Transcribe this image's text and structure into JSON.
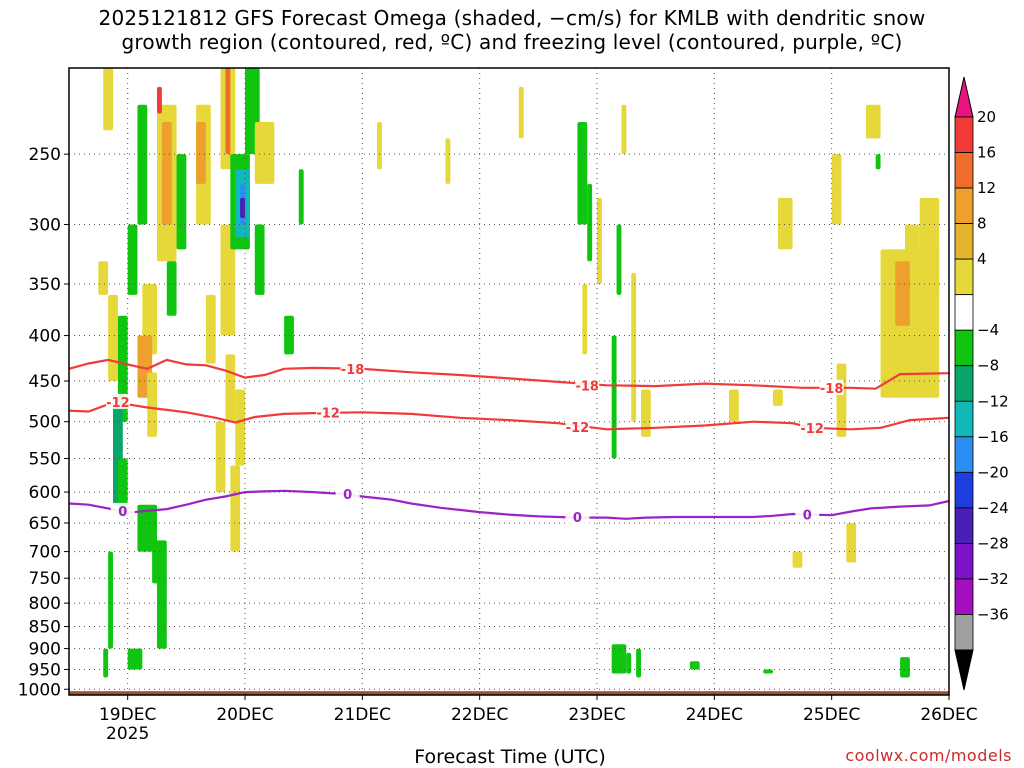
{
  "title": {
    "line1": "2025121812 GFS Forecast Omega (shaded, −cm/s) for KMLB with dendritic snow",
    "line2": "growth region (contoured, red, ºC) and freezing level (contoured, purple, ºC)"
  },
  "credit": "coolwx.com/models",
  "chart_data": {
    "type": "heatmap",
    "xlabel": "Forecast Time (UTC)",
    "x_ticks": [
      {
        "label": "19DEC",
        "sub": "2025",
        "hour": 12
      },
      {
        "label": "20DEC",
        "sub": "",
        "hour": 36
      },
      {
        "label": "21DEC",
        "sub": "",
        "hour": 60
      },
      {
        "label": "22DEC",
        "sub": "",
        "hour": 84
      },
      {
        "label": "23DEC",
        "sub": "",
        "hour": 108
      },
      {
        "label": "24DEC",
        "sub": "",
        "hour": 132
      },
      {
        "label": "25DEC",
        "sub": "",
        "hour": 156
      },
      {
        "label": "26DEC",
        "sub": "",
        "hour": 180
      }
    ],
    "xlim_hours": [
      0,
      180
    ],
    "y_ticks": [
      250,
      300,
      350,
      400,
      450,
      500,
      550,
      600,
      650,
      700,
      750,
      800,
      850,
      900,
      950,
      1000
    ],
    "ylim": [
      200,
      1015
    ],
    "y_scale": "log",
    "grid": true,
    "colorbar": {
      "labels": [
        20,
        16,
        12,
        8,
        4,
        -4,
        -8,
        -12,
        -16,
        -20,
        -24,
        -28,
        -32,
        -36
      ],
      "colors": [
        "#e8157e",
        "#f23a36",
        "#ef6d2a",
        "#eda02c",
        "#e3b52c",
        "#e6d83a",
        "#ffffff",
        "#0fc50f",
        "#0aa56a",
        "#12b8b8",
        "#2a8ef2",
        "#1f3ee0",
        "#4a1fb5",
        "#7a12c8",
        "#a40fbf",
        "#a0a0a0",
        "#000000"
      ]
    },
    "contours": [
      {
        "name": "-18",
        "color": "#ef3b3b",
        "points": [
          [
            0,
            436
          ],
          [
            4,
            430
          ],
          [
            8,
            426
          ],
          [
            12,
            431
          ],
          [
            16,
            436
          ],
          [
            18,
            431
          ],
          [
            20,
            426
          ],
          [
            24,
            431
          ],
          [
            28,
            432
          ],
          [
            32,
            438
          ],
          [
            36,
            446
          ],
          [
            40,
            443
          ],
          [
            44,
            436
          ],
          [
            50,
            435
          ],
          [
            60,
            436
          ],
          [
            70,
            440
          ],
          [
            80,
            443
          ],
          [
            90,
            447
          ],
          [
            100,
            451
          ],
          [
            110,
            455
          ],
          [
            120,
            456
          ],
          [
            130,
            453
          ],
          [
            140,
            455
          ],
          [
            150,
            458
          ],
          [
            160,
            458
          ],
          [
            165,
            459
          ],
          [
            170,
            442
          ],
          [
            180,
            441
          ]
        ],
        "labels": [
          [
            58,
            436
          ],
          [
            106,
            455
          ],
          [
            156,
            458
          ]
        ]
      },
      {
        "name": "-12",
        "color": "#ef3b3b",
        "points": [
          [
            0,
            486
          ],
          [
            4,
            487
          ],
          [
            8,
            478
          ],
          [
            12,
            478
          ],
          [
            16,
            482
          ],
          [
            20,
            485
          ],
          [
            24,
            488
          ],
          [
            30,
            495
          ],
          [
            34,
            501
          ],
          [
            38,
            494
          ],
          [
            44,
            490
          ],
          [
            50,
            489
          ],
          [
            60,
            488
          ],
          [
            70,
            490
          ],
          [
            80,
            495
          ],
          [
            90,
            498
          ],
          [
            100,
            502
          ],
          [
            110,
            510
          ],
          [
            120,
            508
          ],
          [
            130,
            505
          ],
          [
            140,
            500
          ],
          [
            148,
            502
          ],
          [
            152,
            508
          ],
          [
            160,
            510
          ],
          [
            166,
            508
          ],
          [
            172,
            498
          ],
          [
            180,
            495
          ]
        ],
        "labels": [
          [
            10,
            475
          ],
          [
            53,
            488
          ],
          [
            104,
            507
          ],
          [
            152,
            508
          ]
        ]
      },
      {
        "name": "0",
        "color": "#9b22c4",
        "points": [
          [
            0,
            618
          ],
          [
            4,
            620
          ],
          [
            8,
            626
          ],
          [
            12,
            633
          ],
          [
            16,
            630
          ],
          [
            20,
            627
          ],
          [
            24,
            620
          ],
          [
            28,
            612
          ],
          [
            32,
            607
          ],
          [
            36,
            600
          ],
          [
            40,
            599
          ],
          [
            44,
            598
          ],
          [
            50,
            600
          ],
          [
            56,
            603
          ],
          [
            60,
            607
          ],
          [
            66,
            612
          ],
          [
            70,
            618
          ],
          [
            76,
            625
          ],
          [
            84,
            632
          ],
          [
            90,
            636
          ],
          [
            96,
            639
          ],
          [
            100,
            640
          ],
          [
            104,
            641
          ],
          [
            110,
            641
          ],
          [
            114,
            643
          ],
          [
            118,
            641
          ],
          [
            124,
            640
          ],
          [
            130,
            640
          ],
          [
            140,
            640
          ],
          [
            144,
            638
          ],
          [
            148,
            635
          ],
          [
            152,
            636
          ],
          [
            156,
            637
          ],
          [
            160,
            631
          ],
          [
            164,
            626
          ],
          [
            170,
            623
          ],
          [
            176,
            621
          ],
          [
            180,
            614
          ]
        ],
        "labels": [
          [
            11,
            630
          ],
          [
            57,
            603
          ],
          [
            104,
            640
          ],
          [
            151,
            636
          ]
        ]
      }
    ],
    "shaded_cells": [
      {
        "h0": 7,
        "h1": 9,
        "p0": 200,
        "p1": 235,
        "v": 6
      },
      {
        "h0": 8,
        "h1": 10,
        "p0": 360,
        "p1": 450,
        "v": 6
      },
      {
        "h0": 6,
        "h1": 8,
        "p0": 330,
        "p1": 360,
        "v": 6
      },
      {
        "h0": 14,
        "h1": 16,
        "p0": 220,
        "p1": 300,
        "v": -6
      },
      {
        "h0": 12,
        "h1": 14,
        "p0": 300,
        "p1": 360,
        "v": -6
      },
      {
        "h0": 10,
        "h1": 12,
        "p0": 380,
        "p1": 500,
        "v": -6
      },
      {
        "h0": 9,
        "h1": 11,
        "p0": 480,
        "p1": 620,
        "v": -10
      },
      {
        "h0": 10,
        "h1": 12,
        "p0": 550,
        "p1": 640,
        "v": -6
      },
      {
        "h0": 8,
        "h1": 9,
        "p0": 700,
        "p1": 900,
        "v": -6
      },
      {
        "h0": 7,
        "h1": 8,
        "p0": 900,
        "p1": 970,
        "v": -6
      },
      {
        "h0": 12,
        "h1": 15,
        "p0": 900,
        "p1": 950,
        "v": -6
      },
      {
        "h0": 18,
        "h1": 22,
        "p0": 220,
        "p1": 330,
        "v": 6
      },
      {
        "h0": 19,
        "h1": 21,
        "p0": 230,
        "p1": 300,
        "v": 10
      },
      {
        "h0": 18,
        "h1": 19,
        "p0": 210,
        "p1": 225,
        "v": 18
      },
      {
        "h0": 15,
        "h1": 18,
        "p0": 350,
        "p1": 420,
        "v": 6
      },
      {
        "h0": 14,
        "h1": 17,
        "p0": 400,
        "p1": 470,
        "v": 10
      },
      {
        "h0": 16,
        "h1": 18,
        "p0": 440,
        "p1": 520,
        "v": 6
      },
      {
        "h0": 14,
        "h1": 18,
        "p0": 620,
        "p1": 700,
        "v": -6
      },
      {
        "h0": 17,
        "h1": 20,
        "p0": 680,
        "p1": 760,
        "v": -6
      },
      {
        "h0": 18,
        "h1": 20,
        "p0": 750,
        "p1": 900,
        "v": -6
      },
      {
        "h0": 20,
        "h1": 22,
        "p0": 330,
        "p1": 380,
        "v": -6
      },
      {
        "h0": 22,
        "h1": 24,
        "p0": 250,
        "p1": 320,
        "v": -6
      },
      {
        "h0": 26,
        "h1": 29,
        "p0": 220,
        "p1": 300,
        "v": 6
      },
      {
        "h0": 26,
        "h1": 28,
        "p0": 230,
        "p1": 270,
        "v": 10
      },
      {
        "h0": 28,
        "h1": 30,
        "p0": 360,
        "p1": 430,
        "v": 6
      },
      {
        "h0": 31,
        "h1": 34,
        "p0": 200,
        "p1": 260,
        "v": 6
      },
      {
        "h0": 32,
        "h1": 33,
        "p0": 200,
        "p1": 250,
        "v": 12
      },
      {
        "h0": 31,
        "h1": 34,
        "p0": 300,
        "p1": 400,
        "v": 6
      },
      {
        "h0": 32,
        "h1": 34,
        "p0": 420,
        "p1": 500,
        "v": 6
      },
      {
        "h0": 30,
        "h1": 32,
        "p0": 500,
        "p1": 600,
        "v": 6
      },
      {
        "h0": 33,
        "h1": 37,
        "p0": 250,
        "p1": 320,
        "v": -6
      },
      {
        "h0": 34,
        "h1": 37,
        "p0": 260,
        "p1": 310,
        "v": -12
      },
      {
        "h0": 35,
        "h1": 36,
        "p0": 270,
        "p1": 300,
        "v": -18
      },
      {
        "h0": 35,
        "h1": 36,
        "p0": 280,
        "p1": 295,
        "v": -24
      },
      {
        "h0": 36,
        "h1": 39,
        "p0": 200,
        "p1": 250,
        "v": -6
      },
      {
        "h0": 38,
        "h1": 40,
        "p0": 300,
        "p1": 360,
        "v": -6
      },
      {
        "h0": 34,
        "h1": 36,
        "p0": 460,
        "p1": 560,
        "v": 6
      },
      {
        "h0": 33,
        "h1": 35,
        "p0": 560,
        "p1": 700,
        "v": 6
      },
      {
        "h0": 38,
        "h1": 42,
        "p0": 230,
        "p1": 270,
        "v": 6
      },
      {
        "h0": 44,
        "h1": 46,
        "p0": 380,
        "p1": 420,
        "v": -6
      },
      {
        "h0": 47,
        "h1": 48,
        "p0": 260,
        "p1": 300,
        "v": -6
      },
      {
        "h0": 63,
        "h1": 64,
        "p0": 230,
        "p1": 260,
        "v": 6
      },
      {
        "h0": 77,
        "h1": 78,
        "p0": 240,
        "p1": 270,
        "v": 6
      },
      {
        "h0": 92,
        "h1": 93,
        "p0": 210,
        "p1": 240,
        "v": 6
      },
      {
        "h0": 104,
        "h1": 106,
        "p0": 230,
        "p1": 300,
        "v": -6
      },
      {
        "h0": 106,
        "h1": 107,
        "p0": 270,
        "p1": 330,
        "v": -6
      },
      {
        "h0": 105,
        "h1": 106,
        "p0": 350,
        "p1": 420,
        "v": 6
      },
      {
        "h0": 108,
        "h1": 109,
        "p0": 280,
        "p1": 350,
        "v": 6
      },
      {
        "h0": 112,
        "h1": 113,
        "p0": 300,
        "p1": 360,
        "v": -6
      },
      {
        "h0": 111,
        "h1": 112,
        "p0": 400,
        "p1": 550,
        "v": -6
      },
      {
        "h0": 113,
        "h1": 114,
        "p0": 220,
        "p1": 250,
        "v": 6
      },
      {
        "h0": 115,
        "h1": 116,
        "p0": 340,
        "p1": 500,
        "v": 6
      },
      {
        "h0": 117,
        "h1": 119,
        "p0": 460,
        "p1": 520,
        "v": 6
      },
      {
        "h0": 111,
        "h1": 114,
        "p0": 890,
        "p1": 960,
        "v": -6
      },
      {
        "h0": 114,
        "h1": 115,
        "p0": 910,
        "p1": 960,
        "v": -6
      },
      {
        "h0": 116,
        "h1": 117,
        "p0": 900,
        "p1": 970,
        "v": -6
      },
      {
        "h0": 127,
        "h1": 129,
        "p0": 930,
        "p1": 950,
        "v": -6
      },
      {
        "h0": 135,
        "h1": 137,
        "p0": 460,
        "p1": 500,
        "v": 6
      },
      {
        "h0": 144,
        "h1": 146,
        "p0": 460,
        "p1": 480,
        "v": 6
      },
      {
        "h0": 142,
        "h1": 144,
        "p0": 950,
        "p1": 960,
        "v": -6
      },
      {
        "h0": 145,
        "h1": 148,
        "p0": 280,
        "p1": 320,
        "v": 6
      },
      {
        "h0": 148,
        "h1": 150,
        "p0": 700,
        "p1": 730,
        "v": 6
      },
      {
        "h0": 157,
        "h1": 159,
        "p0": 430,
        "p1": 520,
        "v": 6
      },
      {
        "h0": 159,
        "h1": 161,
        "p0": 650,
        "p1": 720,
        "v": 6
      },
      {
        "h0": 156,
        "h1": 158,
        "p0": 250,
        "p1": 300,
        "v": 6
      },
      {
        "h0": 163,
        "h1": 166,
        "p0": 220,
        "p1": 240,
        "v": 6
      },
      {
        "h0": 165,
        "h1": 166,
        "p0": 250,
        "p1": 260,
        "v": -6
      },
      {
        "h0": 166,
        "h1": 178,
        "p0": 320,
        "p1": 470,
        "v": 6
      },
      {
        "h0": 169,
        "h1": 172,
        "p0": 330,
        "p1": 390,
        "v": 10
      },
      {
        "h0": 174,
        "h1": 178,
        "p0": 280,
        "p1": 360,
        "v": 6
      },
      {
        "h0": 171,
        "h1": 174,
        "p0": 300,
        "p1": 330,
        "v": 6
      },
      {
        "h0": 170,
        "h1": 172,
        "p0": 920,
        "p1": 970,
        "v": -6
      }
    ],
    "ground_from_hpa": 1005
  }
}
